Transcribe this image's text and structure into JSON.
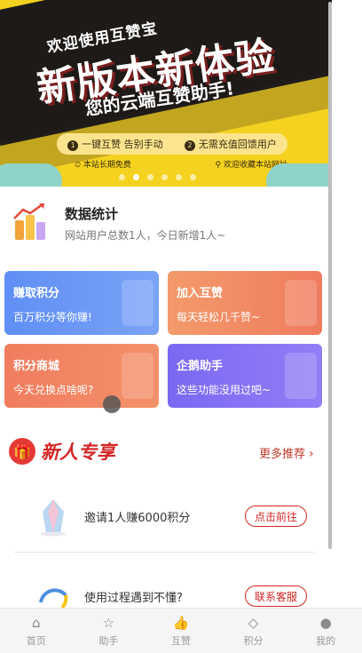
{
  "banner": {
    "small_title": "欢迎使用互赞宝",
    "big_title_left": "新版本",
    "big_title_right": "新体验",
    "subtitle": "您的云端互赞助手!",
    "features": [
      {
        "num": "1",
        "text": "一键互赞 告别手动"
      },
      {
        "num": "2",
        "text": "无需充值回馈用户"
      }
    ],
    "info_left": "本站长期免费",
    "info_right": "欢迎收藏本站网址",
    "slide_count": 6,
    "active_slide": 1
  },
  "stats": {
    "title": "数据统计",
    "subtitle": "网站用户总数1人，今日新增1人~"
  },
  "cards": [
    {
      "title": "赚取积分",
      "subtitle": "百万积分等你赚!",
      "color": "#6a97f6"
    },
    {
      "title": "加入互赞",
      "subtitle": "每天轻松几千赞~",
      "color": "#f08a63"
    },
    {
      "title": "积分商城",
      "subtitle": "今天兑换点啥呢?",
      "color": "#f2876a"
    },
    {
      "title": "企鹅助手",
      "subtitle": "这些功能没用过吧~",
      "color": "#8772f4"
    }
  ],
  "newcomer": {
    "title": "新人专享",
    "more_label": "更多推荐",
    "tasks": [
      {
        "label": "邀请1人赚6000积分",
        "button": "点击前往"
      },
      {
        "label": "使用过程遇到不懂?",
        "button": "联系客服"
      }
    ]
  },
  "nav": {
    "items": [
      {
        "label": "首页",
        "icon": "home-icon"
      },
      {
        "label": "助手",
        "icon": "star-icon"
      },
      {
        "label": "互赞",
        "icon": "thumbs-up-icon"
      },
      {
        "label": "积分",
        "icon": "diamond-icon"
      },
      {
        "label": "我的",
        "icon": "user-icon"
      }
    ]
  },
  "colors": {
    "accent_red": "#d32626",
    "banner_yellow": "#f5d21f"
  }
}
